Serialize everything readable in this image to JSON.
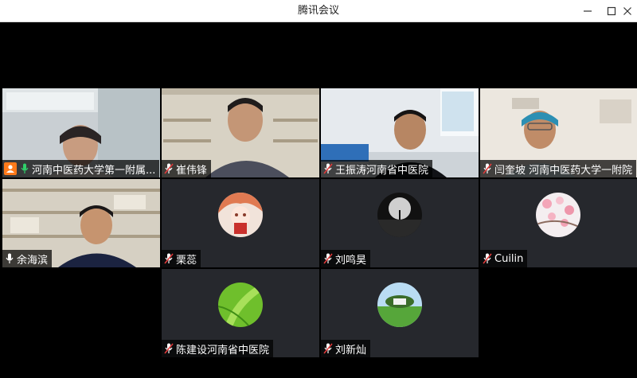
{
  "window": {
    "title": "腾讯会议"
  },
  "colors": {
    "host_badge": "#ff7a1a",
    "active_border": "#21c45b",
    "mic_muted": "#e23b3b",
    "mic_on": "#2fd06a",
    "tile_bg": "#26282d"
  },
  "participants": [
    {
      "name": "河南中医药大学第一附属...",
      "mic": "on",
      "host": true
    },
    {
      "name": "崔伟锋",
      "mic": "muted",
      "host": false
    },
    {
      "name": "王振涛河南省中医院",
      "mic": "muted",
      "host": false
    },
    {
      "name": "闫奎坡 河南中医药大学一附院",
      "mic": "muted",
      "host": false
    },
    {
      "name": "余海滨",
      "mic": "on",
      "host": false
    },
    {
      "name": "栗蕊",
      "mic": "muted",
      "host": false
    },
    {
      "name": "刘鸣昊",
      "mic": "muted",
      "host": false
    },
    {
      "name": "Cuilin",
      "mic": "muted",
      "host": false
    },
    {
      "name": "陈建设河南省中医院",
      "mic": "muted",
      "host": false
    },
    {
      "name": "刘新灿",
      "mic": "muted",
      "host": false
    }
  ]
}
